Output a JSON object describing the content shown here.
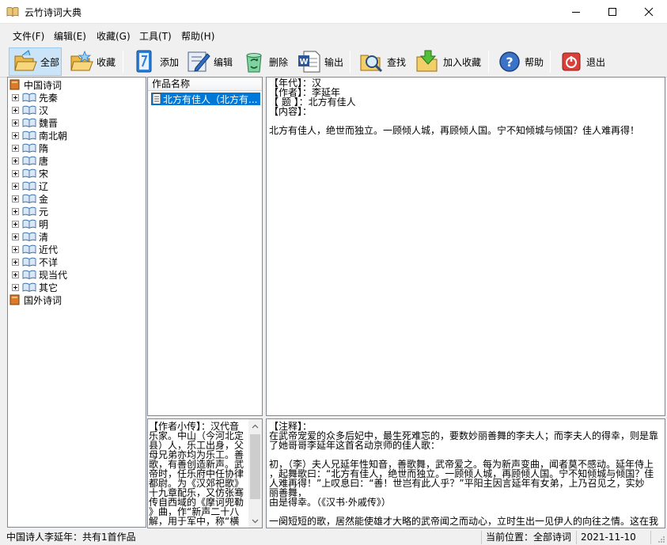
{
  "window": {
    "title": "云竹诗词大典",
    "controls": [
      "minimize-icon",
      "maximize-icon",
      "close-icon"
    ]
  },
  "menu": [
    {
      "label": "文件(F)"
    },
    {
      "label": "编辑(E)"
    },
    {
      "label": "收藏(G)"
    },
    {
      "label": "工具(T)"
    },
    {
      "label": "帮助(H)"
    }
  ],
  "toolbar": [
    {
      "label": "全部",
      "icon": "folder-open-icon",
      "active": true
    },
    {
      "label": "收藏",
      "icon": "favorites-folder-icon"
    },
    {
      "label": "添加",
      "icon": "add-book-icon"
    },
    {
      "label": "编辑",
      "icon": "edit-pencil-icon"
    },
    {
      "label": "删除",
      "icon": "recycle-icon"
    },
    {
      "label": "输出",
      "icon": "word-export-icon"
    },
    {
      "label": "查找",
      "icon": "search-folder-icon"
    },
    {
      "label": "加入收藏",
      "icon": "add-favorite-icon"
    },
    {
      "label": "帮助",
      "icon": "help-icon"
    },
    {
      "label": "退出",
      "icon": "exit-icon"
    }
  ],
  "tree": {
    "root": "中国诗词",
    "dynasties": [
      "先秦",
      "汉",
      "魏晋",
      "南北朝",
      "隋",
      "唐",
      "宋",
      "辽",
      "金",
      "元",
      "明",
      "清",
      "近代",
      "不详",
      "现当代",
      "其它"
    ],
    "foreign": "国外诗词"
  },
  "works": {
    "header": "作品名称",
    "items": [
      "北方有佳人（北方有..."
    ]
  },
  "poem": {
    "lines": [
      "【年代】：汉",
      "【作者】：李延年",
      "【 题 】：北方有佳人",
      "【内容】：",
      "",
      "北方有佳人，绝世而独立。一顾倾人城，再顾倾人国。宁不知倾城与倾国？佳人难再得！"
    ]
  },
  "bio": {
    "lines": [
      "【作者小传】：汉代音",
      "乐家。中山（今河北定",
      "县）人，乐工出身，父",
      "母兄弟亦均为乐工。善",
      "歌，有善创造新声。武",
      "帝时，任乐府中任协律",
      "都尉。为《汉郊祀歌》",
      "十九章配乐，又仿张骞",
      "传自西域的《摩诃兜勒",
      "》曲，作“新声二十八",
      "解，用于军中，称“横"
    ]
  },
  "notes": {
    "lines": [
      "【注释】：",
      "在武帝宠爱的众多后妃中，最生死难忘的，要数妙丽善舞的李夫人；而李夫人的得幸，则是靠",
      "了她哥哥李延年这首名动京师的佳人歌：",
      "",
      "初，（李）夫人兄延年性知音，善歌舞，武帝爱之。每为新声变曲，闻者莫不感动。延年侍上",
      "，起舞歌曰：“北方有佳人，绝世而独立。一顾倾人城，再顾倾人国。宁不知倾城与倾国？佳",
      "人难再得！”上叹息曰：“善！世岂有此人乎？”平阳主因言延年有女弟，上乃召见之，实妙",
      "丽善舞，",
      "由是得幸。（《汉书·外戚传》）",
      "",
      "一阕短短的歌，居然能使雄才大略的武帝闻之而动心，立时生出一见伊人的向往之情。这在我"
    ]
  },
  "status": {
    "works_count": "中国诗人李延年：共有1首作品",
    "position": "当前位置：全部诗词",
    "date": "2021-11-10"
  }
}
